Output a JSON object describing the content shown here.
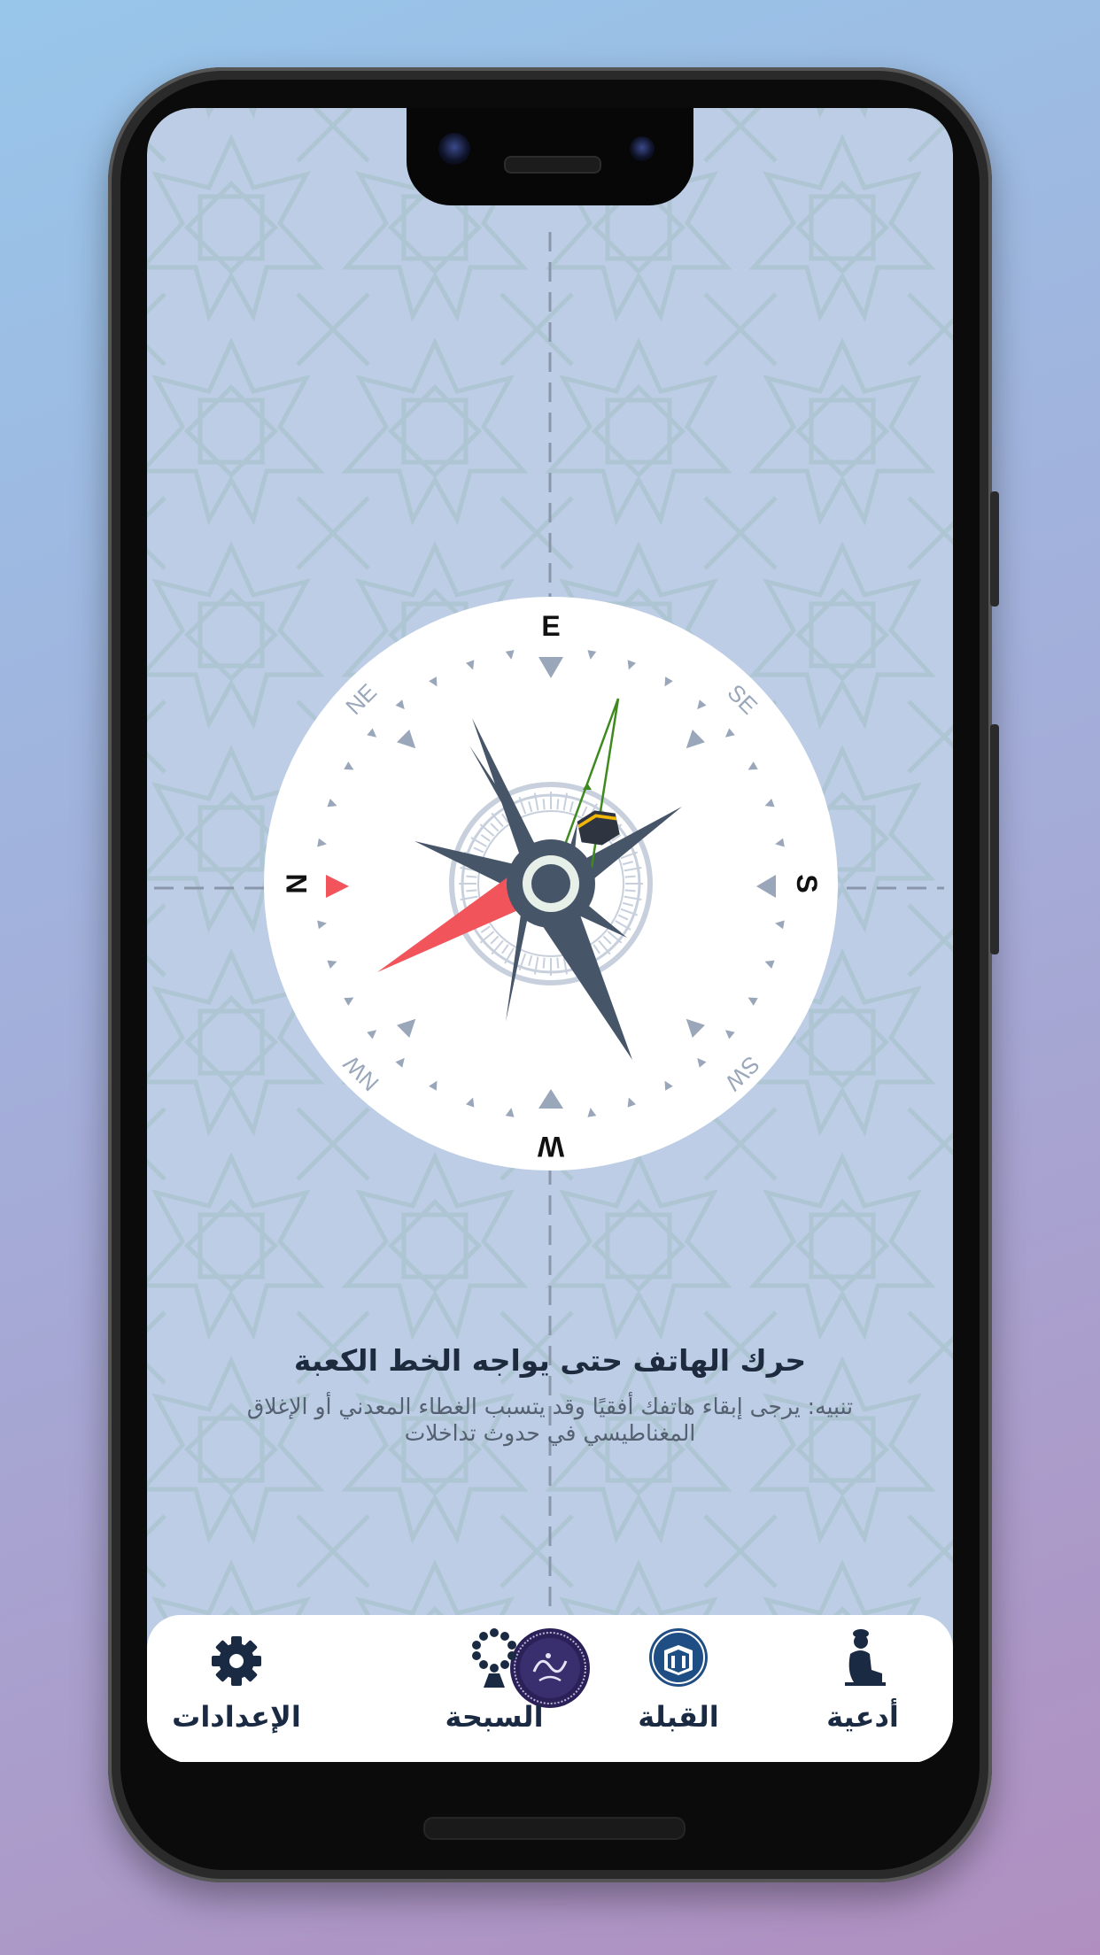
{
  "compass": {
    "north": "N",
    "east": "E",
    "south": "S",
    "west": "W",
    "northeast": "NE",
    "southeast": "SE",
    "southwest": "SW",
    "northwest": "NW"
  },
  "instructions": {
    "title": "حرك الهاتف حتى يواجه الخط الكعبة",
    "note_line1": "تنبيه: يرجى إبقاء هاتفك أفقيًا وقد يتسبب الغطاء المعدني أو الإغلاق",
    "note_line2": "المغناطيسي في حدوث تداخلات"
  },
  "nav": {
    "items": [
      {
        "label": "أدعية",
        "icon": "praying-person-icon"
      },
      {
        "label": "القبلة",
        "icon": "kaaba-icon"
      },
      {
        "label": "",
        "icon": "app-logo-icon"
      },
      {
        "label": "السبحة",
        "icon": "prayer-beads-icon"
      },
      {
        "label": "الإعدادات",
        "icon": "gear-icon"
      }
    ]
  },
  "colors": {
    "accent_red": "#f2545b",
    "rose_dark": "#475569",
    "nav_text": "#1b2a43",
    "app_bg": "#bccde5",
    "kaaba_line": "#3f8a1f"
  }
}
